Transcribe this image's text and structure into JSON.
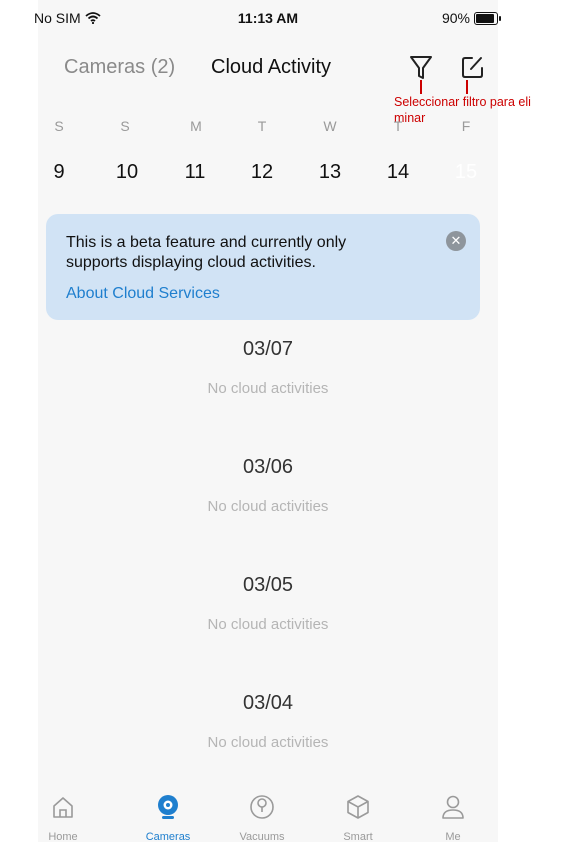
{
  "status_bar": {
    "carrier": "No SIM",
    "time": "11:13 AM",
    "battery": "90%"
  },
  "header": {
    "tab_cameras": "Cameras (2)",
    "tab_cloud": "Cloud Activity",
    "filter_icon": "filter-icon",
    "edit_icon": "edit-icon"
  },
  "annotation": {
    "text": "Seleccionar filtro para eliminar",
    "line1": "Seleccionar filtro para eli",
    "line2": "minar",
    "color": "#cc0000"
  },
  "calendar": {
    "weekdays": [
      "S",
      "S",
      "M",
      "T",
      "W",
      "T",
      "F"
    ],
    "dates": [
      "9",
      "10",
      "11",
      "12",
      "13",
      "14",
      "15"
    ],
    "selected_date": "15"
  },
  "banner": {
    "message": "This is a beta feature and currently only supports displaying cloud activities.",
    "link": "About Cloud Services",
    "close_icon": "close-icon"
  },
  "activity": [
    {
      "date": "03/07",
      "status": "No cloud activities"
    },
    {
      "date": "03/06",
      "status": "No cloud activities"
    },
    {
      "date": "03/05",
      "status": "No cloud activities"
    },
    {
      "date": "03/04",
      "status": "No cloud activities"
    }
  ],
  "tabbar": {
    "items": [
      {
        "label": "Home",
        "icon": "home-icon"
      },
      {
        "label": "Cameras",
        "icon": "camera-icon"
      },
      {
        "label": "Vacuums",
        "icon": "vacuum-icon"
      },
      {
        "label": "Smart",
        "icon": "cube-icon"
      },
      {
        "label": "Me",
        "icon": "person-icon"
      }
    ],
    "active": "Cameras"
  },
  "colors": {
    "accent": "#1f7fce",
    "banner_bg": "#d1e3f5",
    "annotation": "#cc0000"
  }
}
